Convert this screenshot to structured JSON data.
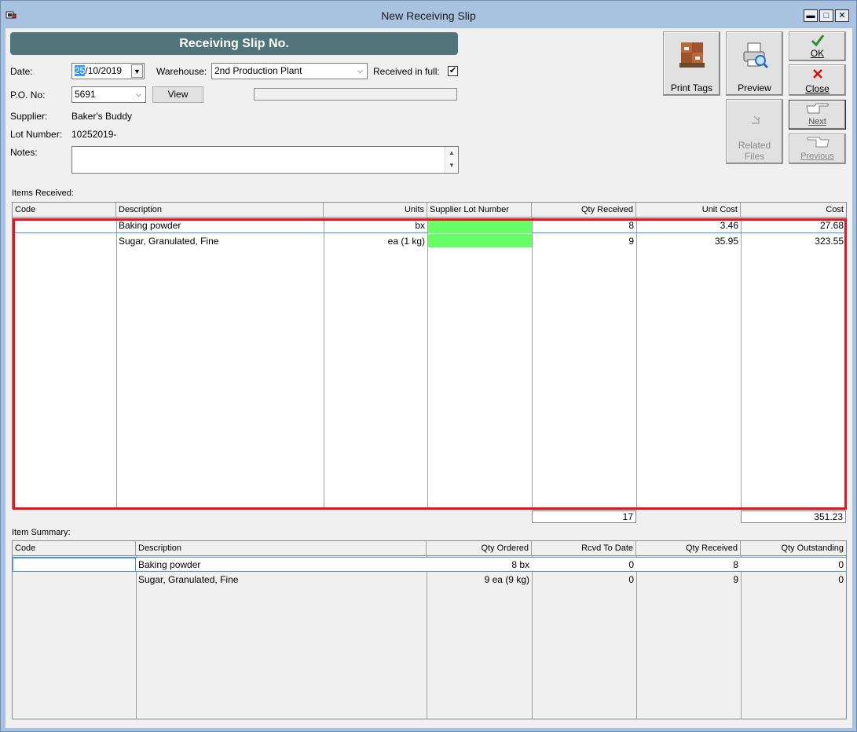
{
  "window": {
    "title": "New Receiving Slip"
  },
  "header": {
    "banner": "Receiving Slip No."
  },
  "form": {
    "date_label": "Date:",
    "date_day": "25",
    "date_rest": "/10/2019",
    "warehouse_label": "Warehouse:",
    "warehouse_value": "2nd Production Plant",
    "received_in_full_label": "Received in full:",
    "received_in_full_checked": true,
    "po_label": "P.O. No:",
    "po_value": "5691",
    "view_label": "View",
    "supplier_label": "Supplier:",
    "supplier_value": "Baker's Buddy",
    "lot_label": "Lot Number:",
    "lot_value": "10252019-",
    "notes_label": "Notes:"
  },
  "toolbar": {
    "print_tags": "Print Tags",
    "preview": "Preview",
    "ok": "OK",
    "close": "Close",
    "related_files_1": "Related",
    "related_files_2": "Files",
    "next": "Next",
    "previous": "Previous"
  },
  "items_received": {
    "label": "Items Received:",
    "columns": [
      "Code",
      "Description",
      "Units",
      "Supplier Lot Number",
      "Qty Received",
      "Unit Cost",
      "Cost"
    ],
    "rows": [
      {
        "code": "",
        "description": "Baking powder",
        "units": "bx",
        "lot": "",
        "qty": "8",
        "unit_cost": "3.46",
        "cost": "27.68"
      },
      {
        "code": "",
        "description": "Sugar, Granulated, Fine",
        "units": "ea (1 kg)",
        "lot": "",
        "qty": "9",
        "unit_cost": "35.95",
        "cost": "323.55"
      }
    ],
    "total_qty": "17",
    "total_cost": "351.23",
    "lot_cell_color": "#66ff66",
    "highlight_color": "#e8141c"
  },
  "item_summary": {
    "label": "Item Summary:",
    "columns": [
      "Code",
      "Description",
      "Qty Ordered",
      "Rcvd To Date",
      "Qty Received",
      "Qty Outstanding"
    ],
    "rows": [
      {
        "code": "",
        "description": "Baking powder",
        "ordered": "8 bx",
        "to_date": "0",
        "received": "8",
        "outstanding": "0"
      },
      {
        "code": "",
        "description": "Sugar, Granulated, Fine",
        "ordered": "9 ea (9 kg)",
        "to_date": "0",
        "received": "9",
        "outstanding": "0"
      }
    ]
  },
  "icons": {
    "app": "receiving-app-icon",
    "print_tags": "pallet-boxes-icon",
    "preview": "printer-preview-icon",
    "ok": "checkmark-icon",
    "close": "red-x-icon",
    "related_files": "document-arrow-icon",
    "next": "pointing-hand-right-icon",
    "previous": "pointing-hand-left-icon"
  }
}
